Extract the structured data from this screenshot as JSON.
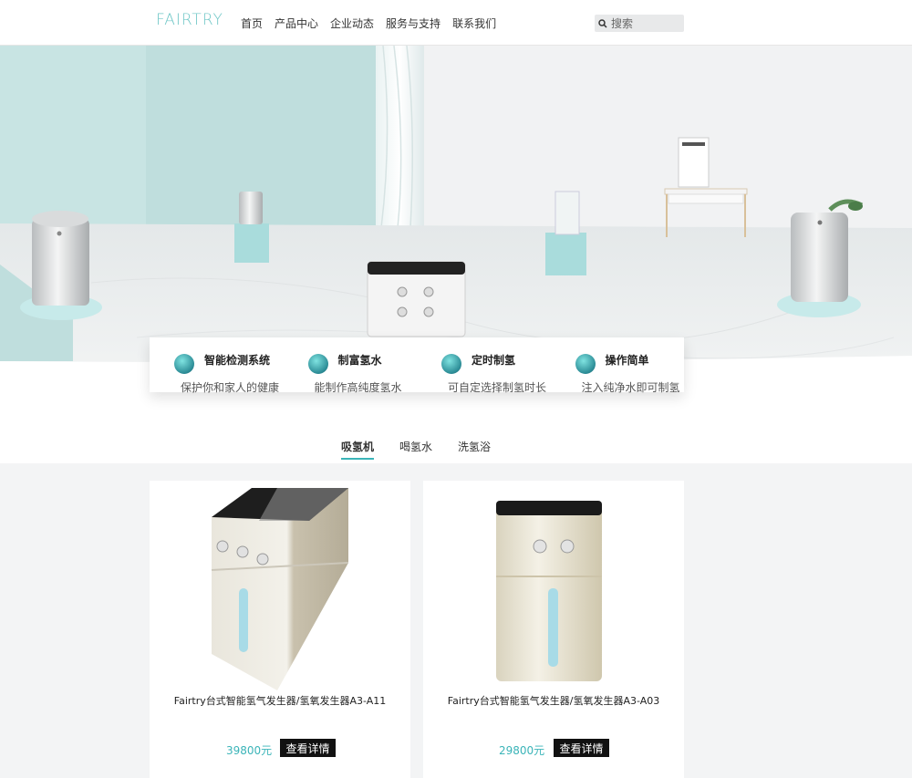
{
  "header": {
    "logo": "FAIRTRY",
    "nav": [
      "首页",
      "产品中心",
      "企业动态",
      "服务与支持",
      "联系我们"
    ],
    "search_placeholder": "搜索"
  },
  "features": [
    {
      "icon": "magnifier-icon",
      "title": "智能检测系统",
      "desc": "保护你和家人的健康"
    },
    {
      "icon": "water-drop-icon",
      "title": "制富氢水",
      "desc": "能制作高纯度氢水"
    },
    {
      "icon": "alarm-clock-icon",
      "title": "定时制氢",
      "desc": "可自定选择制氢时长"
    },
    {
      "icon": "bottle-icon",
      "title": "操作简单",
      "desc": "注入纯净水即可制氢"
    }
  ],
  "tabs": [
    {
      "label": "吸氢机",
      "active": true
    },
    {
      "label": "喝氢水",
      "active": false
    },
    {
      "label": "洗氢浴",
      "active": false
    }
  ],
  "products": [
    {
      "name": "Fairtry台式智能氢气发生器/氢氧发生器A3-A11",
      "price": "39800元",
      "button": "查看详情"
    },
    {
      "name": "Fairtry台式智能氢气发生器/氢氧发生器A3-A03",
      "price": "29800元",
      "button": "查看详情"
    }
  ],
  "colors": {
    "accent": "#3ab4b8",
    "hero_wall": "#bfdedd"
  }
}
